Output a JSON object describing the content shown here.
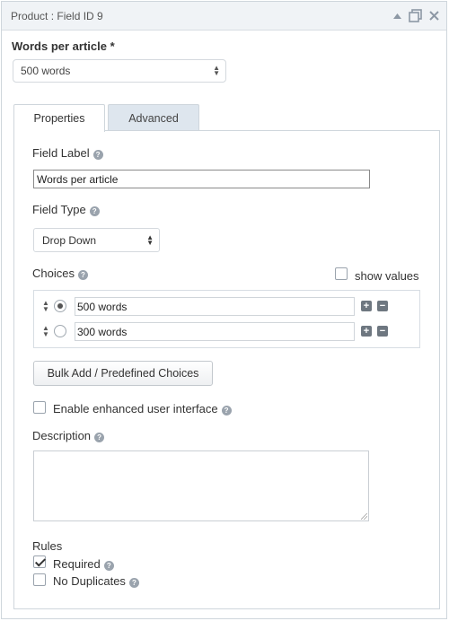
{
  "header": {
    "title": "Product : Field ID 9",
    "icons": [
      "collapse-icon",
      "duplicate-icon",
      "delete-icon"
    ]
  },
  "preview": {
    "field_label": "Words per article *",
    "selected_value": "500 words"
  },
  "tabs": [
    {
      "label": "Properties",
      "active": true
    },
    {
      "label": "Advanced",
      "active": false
    }
  ],
  "properties": {
    "field_label": {
      "label": "Field Label",
      "value": "Words per article"
    },
    "field_type": {
      "label": "Field Type",
      "selected": "Drop Down"
    },
    "choices": {
      "label": "Choices",
      "show_values_label": "show values",
      "show_values_checked": false,
      "items": [
        {
          "text": "500 words",
          "selected": true
        },
        {
          "text": "300 words",
          "selected": false
        }
      ]
    },
    "bulk_add_label": "Bulk Add / Predefined Choices",
    "enhanced_ui": {
      "label": "Enable enhanced user interface",
      "checked": false
    },
    "description": {
      "label": "Description",
      "value": ""
    },
    "rules": {
      "label": "Rules",
      "required": {
        "label": "Required",
        "checked": true
      },
      "no_duplicates": {
        "label": "No Duplicates",
        "checked": false
      }
    }
  },
  "colors": {
    "titlebar_bg": "#f0f3f6",
    "inactive_tab_bg": "#dee6ee",
    "border": "#cfd6dc",
    "icon_gray": "#6e7780"
  }
}
